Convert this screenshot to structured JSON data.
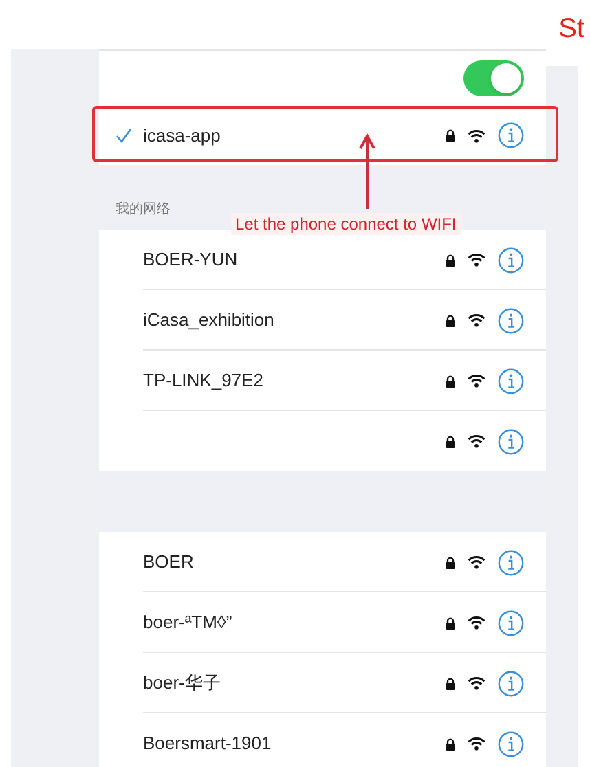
{
  "heading_fragment": "St",
  "wifi_toggle": {
    "on": true
  },
  "connected_network": {
    "name": "icasa-app",
    "selected": true,
    "secured": true
  },
  "section_header": "我的网络",
  "my_networks": [
    {
      "name": "BOER-YUN",
      "secured": true
    },
    {
      "name": "iCasa_exhibition",
      "secured": true
    },
    {
      "name": "TP-LINK_97E2",
      "secured": true
    },
    {
      "secured": true
    }
  ],
  "other_networks": [
    {
      "name": "BOER",
      "secured": true
    },
    {
      "name": "boer-ªTM◊”",
      "secured": true
    },
    {
      "name": "boer-华子",
      "secured": true
    },
    {
      "name": "Boersmart-1901",
      "secured": true
    }
  ],
  "annotation": {
    "text": "Let the phone connect to WIFI"
  }
}
